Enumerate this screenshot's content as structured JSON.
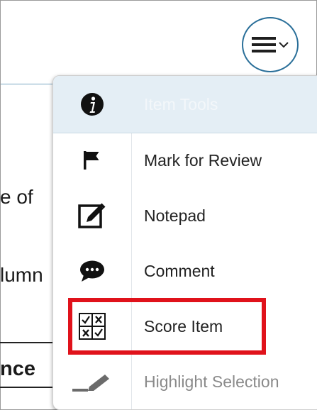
{
  "background": {
    "lines": [
      "e of",
      "lumn",
      "nce"
    ]
  },
  "menu_button": {
    "icon": "hamburger-icon",
    "chevron": "chevron-down-icon"
  },
  "menu": {
    "header": {
      "label": "Item Tools",
      "icon": "info-icon"
    },
    "items": [
      {
        "label": "Mark for Review",
        "icon": "flag-icon"
      },
      {
        "label": "Notepad",
        "icon": "notepad-icon"
      },
      {
        "label": "Comment",
        "icon": "comment-icon"
      },
      {
        "label": "Score Item",
        "icon": "score-grid-icon"
      },
      {
        "label": "Highlight Selection",
        "icon": "highlighter-icon"
      }
    ]
  },
  "colors": {
    "accent": "#2a6f99",
    "highlight_border": "#e0121b",
    "header_bg": "#e4eef5",
    "disabled_text": "#8a8a8a"
  }
}
